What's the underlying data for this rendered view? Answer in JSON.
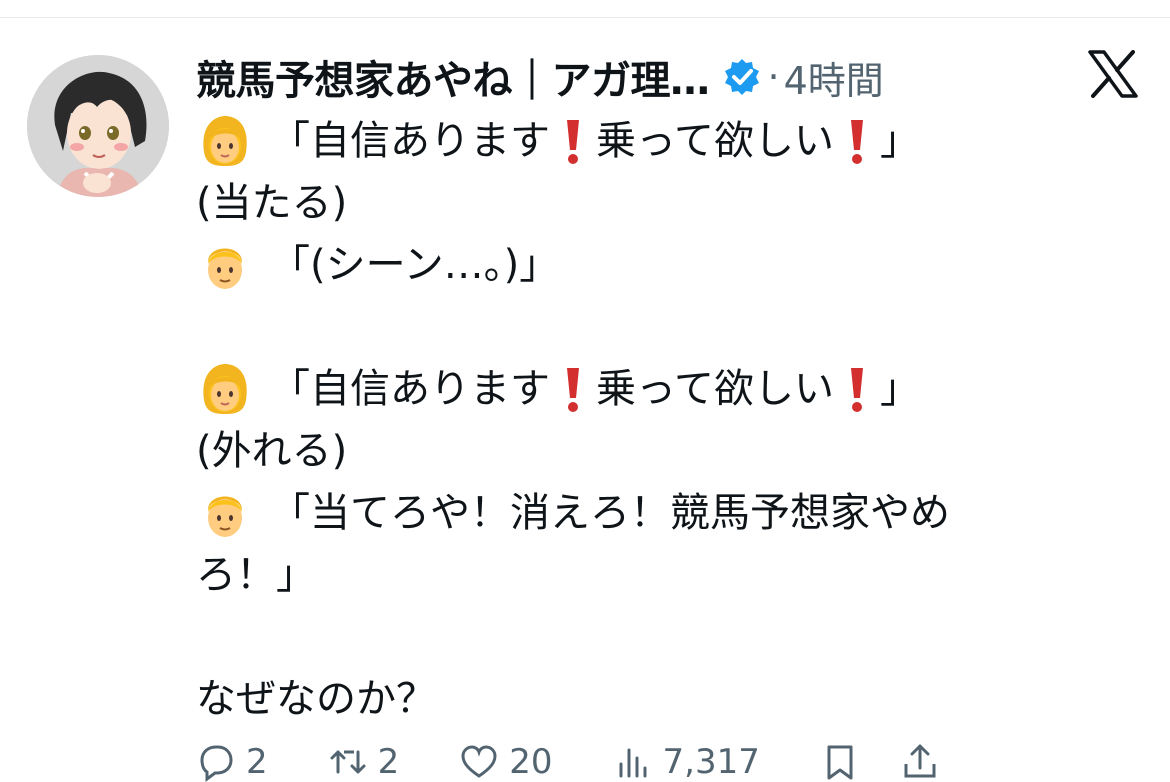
{
  "post": {
    "author_name": "競馬予想家あやね｜アガ理…",
    "separator": "·",
    "time": "4時間",
    "lines": [
      {
        "emoji": "woman-emoji",
        "text": "「自信あります",
        "text2": "乗って欲しい",
        "text3": "」"
      },
      {
        "text": "(当たる)"
      },
      {
        "emoji": "man-emoji",
        "text": "「(シーン…。)」"
      },
      {
        "text": ""
      },
      {
        "emoji": "woman-emoji",
        "text": "「自信あります",
        "text2": "乗って欲しい",
        "text3": "」"
      },
      {
        "text": "(外れる)"
      },
      {
        "emoji": "man-emoji",
        "text": "「当てろや！消えろ！競馬予想家やめ"
      },
      {
        "text": "ろ！」"
      },
      {
        "text": ""
      },
      {
        "text": "なぜなのか？"
      }
    ]
  },
  "actions": {
    "reply_count": "2",
    "retweet_count": "2",
    "like_count": "20",
    "views_count": "7,317"
  },
  "icons": {
    "verified": "verified-badge-icon",
    "logo": "x-logo-icon",
    "exclamation": "red-exclamation-emoji",
    "reply": "reply-icon",
    "retweet": "retweet-icon",
    "like": "heart-icon",
    "views": "views-icon",
    "bookmark": "bookmark-icon",
    "share": "share-icon"
  },
  "colors": {
    "text": "#0f1419",
    "secondary": "#536471",
    "verified": "#1d9bf0",
    "exclamation": "#d32f2f"
  }
}
